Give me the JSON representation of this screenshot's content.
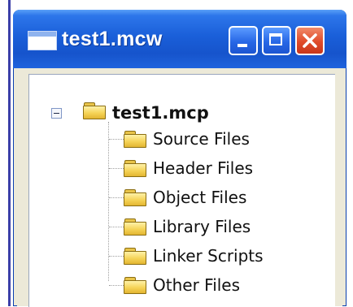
{
  "window": {
    "title": "test1.mcw",
    "icon": "window-app-icon",
    "controls": {
      "minimize": "minimize-icon",
      "maximize": "maximize-icon",
      "close": "close-icon"
    }
  },
  "tree": {
    "root": {
      "label": "test1.mcp",
      "expanded": true,
      "icon": "folder-icon"
    },
    "children": [
      {
        "label": "Source Files",
        "icon": "folder-icon"
      },
      {
        "label": "Header Files",
        "icon": "folder-icon"
      },
      {
        "label": "Object Files",
        "icon": "folder-icon"
      },
      {
        "label": "Library Files",
        "icon": "folder-icon"
      },
      {
        "label": "Linker Scripts",
        "icon": "folder-icon"
      },
      {
        "label": "Other Files",
        "icon": "folder-icon"
      }
    ]
  },
  "colors": {
    "titlebar": "#1654cc",
    "close_button": "#e04b2a",
    "folder": "#f5d357",
    "client_background": "#ece9d8"
  }
}
